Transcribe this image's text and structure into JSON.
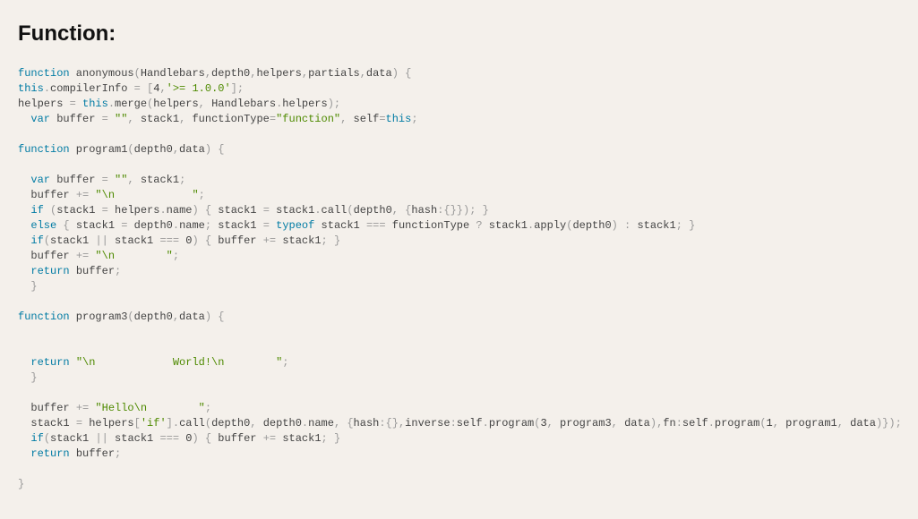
{
  "heading": "Function:",
  "code": {
    "tokens": [
      {
        "c": "kw",
        "t": "function"
      },
      {
        "c": "id",
        "t": " anonymous"
      },
      {
        "c": "op",
        "t": "("
      },
      {
        "c": "id",
        "t": "Handlebars"
      },
      {
        "c": "op",
        "t": ","
      },
      {
        "c": "id",
        "t": "depth0"
      },
      {
        "c": "op",
        "t": ","
      },
      {
        "c": "id",
        "t": "helpers"
      },
      {
        "c": "op",
        "t": ","
      },
      {
        "c": "id",
        "t": "partials"
      },
      {
        "c": "op",
        "t": ","
      },
      {
        "c": "id",
        "t": "data"
      },
      {
        "c": "op",
        "t": ") {"
      },
      {
        "nl": 1
      },
      {
        "c": "kw",
        "t": "this"
      },
      {
        "c": "op",
        "t": "."
      },
      {
        "c": "id",
        "t": "compilerInfo "
      },
      {
        "c": "op",
        "t": "= ["
      },
      {
        "c": "num",
        "t": "4"
      },
      {
        "c": "op",
        "t": ","
      },
      {
        "c": "str",
        "t": "'>= 1.0.0'"
      },
      {
        "c": "op",
        "t": "];"
      },
      {
        "nl": 1
      },
      {
        "c": "id",
        "t": "helpers "
      },
      {
        "c": "op",
        "t": "= "
      },
      {
        "c": "kw",
        "t": "this"
      },
      {
        "c": "op",
        "t": "."
      },
      {
        "c": "id",
        "t": "merge"
      },
      {
        "c": "op",
        "t": "("
      },
      {
        "c": "id",
        "t": "helpers"
      },
      {
        "c": "op",
        "t": ", "
      },
      {
        "c": "id",
        "t": "Handlebars"
      },
      {
        "c": "op",
        "t": "."
      },
      {
        "c": "id",
        "t": "helpers"
      },
      {
        "c": "op",
        "t": ");"
      },
      {
        "nl": 1
      },
      {
        "c": "id",
        "t": "  "
      },
      {
        "c": "kw",
        "t": "var"
      },
      {
        "c": "id",
        "t": " buffer "
      },
      {
        "c": "op",
        "t": "= "
      },
      {
        "c": "str",
        "t": "\"\""
      },
      {
        "c": "op",
        "t": ", "
      },
      {
        "c": "id",
        "t": "stack1"
      },
      {
        "c": "op",
        "t": ", "
      },
      {
        "c": "id",
        "t": "functionType"
      },
      {
        "c": "op",
        "t": "="
      },
      {
        "c": "str",
        "t": "\"function\""
      },
      {
        "c": "op",
        "t": ", "
      },
      {
        "c": "id",
        "t": "self"
      },
      {
        "c": "op",
        "t": "="
      },
      {
        "c": "kw",
        "t": "this"
      },
      {
        "c": "op",
        "t": ";"
      },
      {
        "nl": 2
      },
      {
        "c": "kw",
        "t": "function"
      },
      {
        "c": "id",
        "t": " program1"
      },
      {
        "c": "op",
        "t": "("
      },
      {
        "c": "id",
        "t": "depth0"
      },
      {
        "c": "op",
        "t": ","
      },
      {
        "c": "id",
        "t": "data"
      },
      {
        "c": "op",
        "t": ") {"
      },
      {
        "nl": 2
      },
      {
        "c": "id",
        "t": "  "
      },
      {
        "c": "kw",
        "t": "var"
      },
      {
        "c": "id",
        "t": " buffer "
      },
      {
        "c": "op",
        "t": "= "
      },
      {
        "c": "str",
        "t": "\"\""
      },
      {
        "c": "op",
        "t": ", "
      },
      {
        "c": "id",
        "t": "stack1"
      },
      {
        "c": "op",
        "t": ";"
      },
      {
        "nl": 1
      },
      {
        "c": "id",
        "t": "  buffer "
      },
      {
        "c": "op",
        "t": "+= "
      },
      {
        "c": "str",
        "t": "\"\\n            \""
      },
      {
        "c": "op",
        "t": ";"
      },
      {
        "nl": 1
      },
      {
        "c": "id",
        "t": "  "
      },
      {
        "c": "kw",
        "t": "if"
      },
      {
        "c": "id",
        "t": " "
      },
      {
        "c": "op",
        "t": "("
      },
      {
        "c": "id",
        "t": "stack1 "
      },
      {
        "c": "op",
        "t": "= "
      },
      {
        "c": "id",
        "t": "helpers"
      },
      {
        "c": "op",
        "t": "."
      },
      {
        "c": "id",
        "t": "name"
      },
      {
        "c": "op",
        "t": ") { "
      },
      {
        "c": "id",
        "t": "stack1 "
      },
      {
        "c": "op",
        "t": "= "
      },
      {
        "c": "id",
        "t": "stack1"
      },
      {
        "c": "op",
        "t": "."
      },
      {
        "c": "id",
        "t": "call"
      },
      {
        "c": "op",
        "t": "("
      },
      {
        "c": "id",
        "t": "depth0"
      },
      {
        "c": "op",
        "t": ", {"
      },
      {
        "c": "id",
        "t": "hash"
      },
      {
        "c": "op",
        "t": ":{}}); }"
      },
      {
        "nl": 1
      },
      {
        "c": "id",
        "t": "  "
      },
      {
        "c": "kw",
        "t": "else"
      },
      {
        "c": "id",
        "t": " "
      },
      {
        "c": "op",
        "t": "{ "
      },
      {
        "c": "id",
        "t": "stack1 "
      },
      {
        "c": "op",
        "t": "= "
      },
      {
        "c": "id",
        "t": "depth0"
      },
      {
        "c": "op",
        "t": "."
      },
      {
        "c": "id",
        "t": "name"
      },
      {
        "c": "op",
        "t": "; "
      },
      {
        "c": "id",
        "t": "stack1 "
      },
      {
        "c": "op",
        "t": "= "
      },
      {
        "c": "kw",
        "t": "typeof"
      },
      {
        "c": "id",
        "t": " stack1 "
      },
      {
        "c": "op",
        "t": "=== "
      },
      {
        "c": "id",
        "t": "functionType "
      },
      {
        "c": "op",
        "t": "? "
      },
      {
        "c": "id",
        "t": "stack1"
      },
      {
        "c": "op",
        "t": "."
      },
      {
        "c": "id",
        "t": "apply"
      },
      {
        "c": "op",
        "t": "("
      },
      {
        "c": "id",
        "t": "depth0"
      },
      {
        "c": "op",
        "t": ") : "
      },
      {
        "c": "id",
        "t": "stack1"
      },
      {
        "c": "op",
        "t": "; }"
      },
      {
        "nl": 1
      },
      {
        "c": "id",
        "t": "  "
      },
      {
        "c": "kw",
        "t": "if"
      },
      {
        "c": "op",
        "t": "("
      },
      {
        "c": "id",
        "t": "stack1 "
      },
      {
        "c": "op",
        "t": "|| "
      },
      {
        "c": "id",
        "t": "stack1 "
      },
      {
        "c": "op",
        "t": "=== "
      },
      {
        "c": "num",
        "t": "0"
      },
      {
        "c": "op",
        "t": ") { "
      },
      {
        "c": "id",
        "t": "buffer "
      },
      {
        "c": "op",
        "t": "+= "
      },
      {
        "c": "id",
        "t": "stack1"
      },
      {
        "c": "op",
        "t": "; }"
      },
      {
        "nl": 1
      },
      {
        "c": "id",
        "t": "  buffer "
      },
      {
        "c": "op",
        "t": "+= "
      },
      {
        "c": "str",
        "t": "\"\\n        \""
      },
      {
        "c": "op",
        "t": ";"
      },
      {
        "nl": 1
      },
      {
        "c": "id",
        "t": "  "
      },
      {
        "c": "kw",
        "t": "return"
      },
      {
        "c": "id",
        "t": " buffer"
      },
      {
        "c": "op",
        "t": ";"
      },
      {
        "nl": 1
      },
      {
        "c": "id",
        "t": "  "
      },
      {
        "c": "op",
        "t": "}"
      },
      {
        "nl": 2
      },
      {
        "c": "kw",
        "t": "function"
      },
      {
        "c": "id",
        "t": " program3"
      },
      {
        "c": "op",
        "t": "("
      },
      {
        "c": "id",
        "t": "depth0"
      },
      {
        "c": "op",
        "t": ","
      },
      {
        "c": "id",
        "t": "data"
      },
      {
        "c": "op",
        "t": ") {"
      },
      {
        "nl": 3
      },
      {
        "c": "id",
        "t": "  "
      },
      {
        "c": "kw",
        "t": "return"
      },
      {
        "c": "id",
        "t": " "
      },
      {
        "c": "str",
        "t": "\"\\n            World!\\n        \""
      },
      {
        "c": "op",
        "t": ";"
      },
      {
        "nl": 1
      },
      {
        "c": "id",
        "t": "  "
      },
      {
        "c": "op",
        "t": "}"
      },
      {
        "nl": 2
      },
      {
        "c": "id",
        "t": "  buffer "
      },
      {
        "c": "op",
        "t": "+= "
      },
      {
        "c": "str",
        "t": "\"Hello\\n        \""
      },
      {
        "c": "op",
        "t": ";"
      },
      {
        "nl": 1
      },
      {
        "c": "id",
        "t": "  stack1 "
      },
      {
        "c": "op",
        "t": "= "
      },
      {
        "c": "id",
        "t": "helpers"
      },
      {
        "c": "op",
        "t": "["
      },
      {
        "c": "str",
        "t": "'if'"
      },
      {
        "c": "op",
        "t": "]."
      },
      {
        "c": "id",
        "t": "call"
      },
      {
        "c": "op",
        "t": "("
      },
      {
        "c": "id",
        "t": "depth0"
      },
      {
        "c": "op",
        "t": ", "
      },
      {
        "c": "id",
        "t": "depth0"
      },
      {
        "c": "op",
        "t": "."
      },
      {
        "c": "id",
        "t": "name"
      },
      {
        "c": "op",
        "t": ", {"
      },
      {
        "c": "id",
        "t": "hash"
      },
      {
        "c": "op",
        "t": ":{},"
      },
      {
        "c": "id",
        "t": "inverse"
      },
      {
        "c": "op",
        "t": ":"
      },
      {
        "c": "id",
        "t": "self"
      },
      {
        "c": "op",
        "t": "."
      },
      {
        "c": "id",
        "t": "program"
      },
      {
        "c": "op",
        "t": "("
      },
      {
        "c": "num",
        "t": "3"
      },
      {
        "c": "op",
        "t": ", "
      },
      {
        "c": "id",
        "t": "program3"
      },
      {
        "c": "op",
        "t": ", "
      },
      {
        "c": "id",
        "t": "data"
      },
      {
        "c": "op",
        "t": "),"
      },
      {
        "c": "id",
        "t": "fn"
      },
      {
        "c": "op",
        "t": ":"
      },
      {
        "c": "id",
        "t": "self"
      },
      {
        "c": "op",
        "t": "."
      },
      {
        "c": "id",
        "t": "program"
      },
      {
        "c": "op",
        "t": "("
      },
      {
        "c": "num",
        "t": "1"
      },
      {
        "c": "op",
        "t": ", "
      },
      {
        "c": "id",
        "t": "program1"
      },
      {
        "c": "op",
        "t": ", "
      },
      {
        "c": "id",
        "t": "data"
      },
      {
        "c": "op",
        "t": ")});"
      },
      {
        "nl": 1
      },
      {
        "c": "id",
        "t": "  "
      },
      {
        "c": "kw",
        "t": "if"
      },
      {
        "c": "op",
        "t": "("
      },
      {
        "c": "id",
        "t": "stack1 "
      },
      {
        "c": "op",
        "t": "|| "
      },
      {
        "c": "id",
        "t": "stack1 "
      },
      {
        "c": "op",
        "t": "=== "
      },
      {
        "c": "num",
        "t": "0"
      },
      {
        "c": "op",
        "t": ") { "
      },
      {
        "c": "id",
        "t": "buffer "
      },
      {
        "c": "op",
        "t": "+= "
      },
      {
        "c": "id",
        "t": "stack1"
      },
      {
        "c": "op",
        "t": "; }"
      },
      {
        "nl": 1
      },
      {
        "c": "id",
        "t": "  "
      },
      {
        "c": "kw",
        "t": "return"
      },
      {
        "c": "id",
        "t": " buffer"
      },
      {
        "c": "op",
        "t": ";"
      },
      {
        "nl": 2
      },
      {
        "c": "op",
        "t": "}"
      }
    ]
  }
}
